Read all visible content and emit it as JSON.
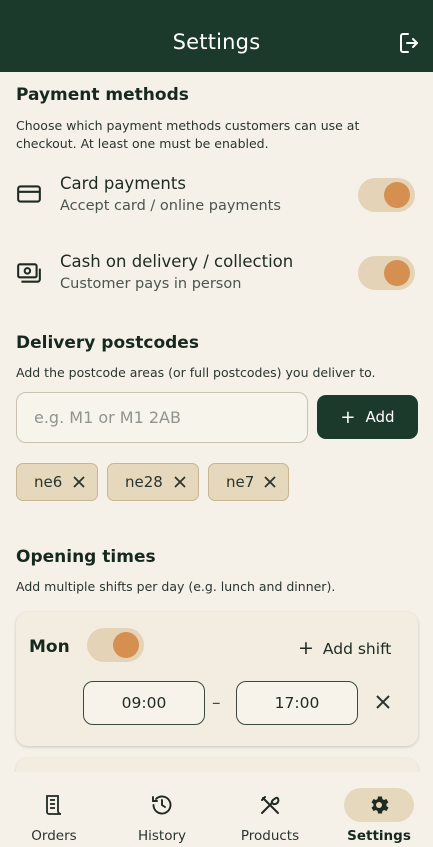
{
  "header": {
    "title": "Settings",
    "logout_icon": "logout-icon"
  },
  "payment": {
    "heading": "Payment methods",
    "description": "Choose which payment methods customers can use at checkout. At least one must be enabled.",
    "methods": [
      {
        "icon": "credit-card-icon",
        "title": "Card payments",
        "subtitle": "Accept card / online payments",
        "enabled": true
      },
      {
        "icon": "cash-icon",
        "title": "Cash on delivery / collection",
        "subtitle": "Customer pays in person",
        "enabled": true
      }
    ]
  },
  "postcodes": {
    "heading": "Delivery postcodes",
    "description": "Add the postcode areas (or full postcodes) you deliver to.",
    "input_placeholder": "e.g. M1 or M1 2AB",
    "input_value": "",
    "add_label": "Add",
    "chips": [
      "ne6",
      "ne28",
      "ne7"
    ]
  },
  "opening": {
    "heading": "Opening times",
    "description": "Add multiple shifts per day (e.g. lunch and dinner).",
    "days": [
      {
        "day": "Mon",
        "open": true,
        "add_shift_label": "Add shift",
        "shifts": [
          {
            "start": "09:00",
            "end": "17:00"
          }
        ]
      }
    ]
  },
  "tabs": [
    {
      "label": "Orders",
      "icon": "receipt-icon",
      "active": false
    },
    {
      "label": "History",
      "icon": "history-icon",
      "active": false
    },
    {
      "label": "Products",
      "icon": "utensils-icon",
      "active": false
    },
    {
      "label": "Settings",
      "icon": "gear-icon",
      "active": true
    }
  ],
  "colors": {
    "header_bg": "#1b3a2b",
    "background": "#f5f1e8",
    "accent": "#d48f51",
    "toggle_track": "#e4d3b6",
    "chip_bg": "#e6d8bd"
  }
}
